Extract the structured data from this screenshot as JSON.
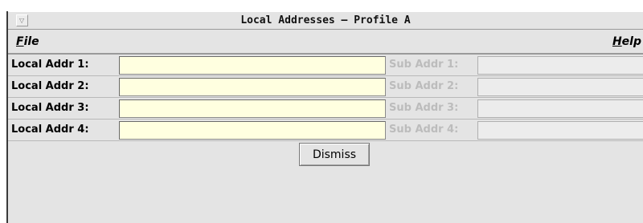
{
  "window": {
    "title": "Local Addresses – Profile A"
  },
  "menubar": {
    "file_mnemonic": "F",
    "file_rest": "ile",
    "help_mnemonic": "H",
    "help_rest": "elp"
  },
  "rows": [
    {
      "local_label": "Local Addr 1:",
      "local_value": "",
      "sub_label": "Sub Addr 1:",
      "sub_value": ""
    },
    {
      "local_label": "Local Addr 2:",
      "local_value": "",
      "sub_label": "Sub Addr 2:",
      "sub_value": ""
    },
    {
      "local_label": "Local Addr 3:",
      "local_value": "",
      "sub_label": "Sub Addr 3:",
      "sub_value": ""
    },
    {
      "local_label": "Local Addr 4:",
      "local_value": "",
      "sub_label": "Sub Addr 4:",
      "sub_value": ""
    }
  ],
  "buttons": {
    "dismiss": "Dismiss"
  },
  "colors": {
    "window_bg": "#e4e4e4",
    "local_field_bg": "#ffffe0",
    "sub_field_bg": "#ececec",
    "disabled_text": "#bcbcbc"
  },
  "icons": {
    "window_menu": "triangle-down-icon"
  }
}
